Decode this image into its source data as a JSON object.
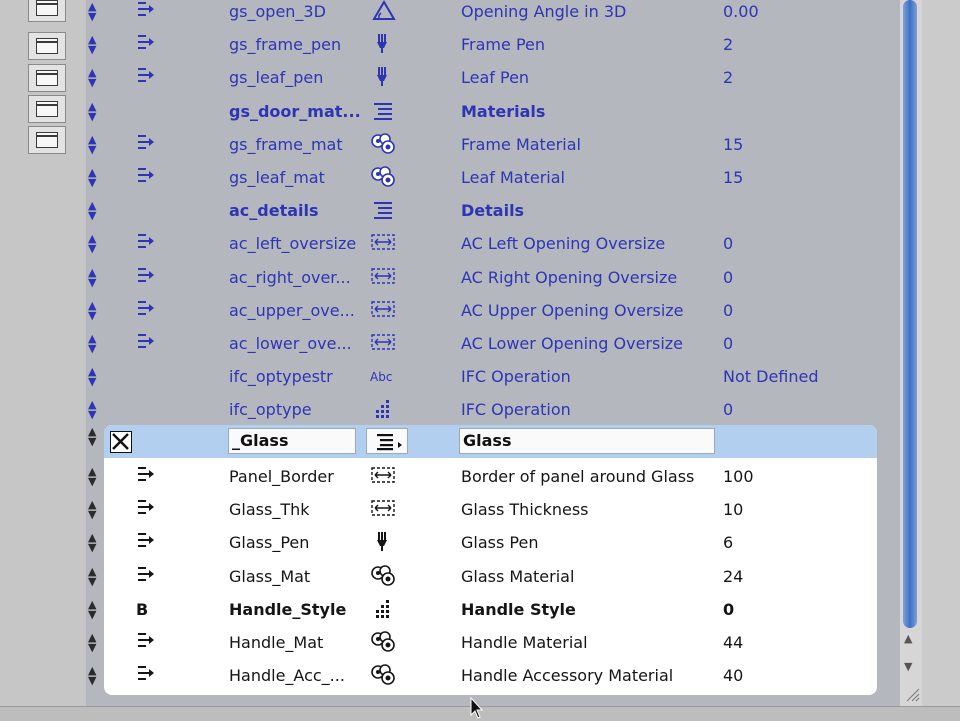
{
  "colors": {
    "list_bg": "#b5b7be",
    "dim_text": "#2d35b4",
    "selection": "#b3cff0",
    "scroll_thumb": "#3f6fc5"
  },
  "upper_rows": [
    {
      "flag": "set",
      "variable": "gs_open_3D",
      "type_icon": "angle-icon",
      "name": "Opening Angle in 3D",
      "value": "0.00",
      "bold": false
    },
    {
      "flag": "set",
      "variable": "gs_frame_pen",
      "type_icon": "pen-icon",
      "name": "Frame Pen",
      "value": "2",
      "bold": false
    },
    {
      "flag": "set",
      "variable": "gs_leaf_pen",
      "type_icon": "pen-icon",
      "name": "Leaf Pen",
      "value": "2",
      "bold": false
    },
    {
      "flag": "",
      "variable": "gs_door_mat...",
      "type_icon": "title-icon",
      "name": "Materials",
      "value": "",
      "bold": true
    },
    {
      "flag": "set",
      "variable": "gs_frame_mat",
      "type_icon": "material-icon",
      "name": "Frame Material",
      "value": "15",
      "bold": false
    },
    {
      "flag": "set",
      "variable": "gs_leaf_mat",
      "type_icon": "material-icon",
      "name": "Leaf Material",
      "value": "15",
      "bold": false
    },
    {
      "flag": "",
      "variable": "ac_details",
      "type_icon": "title-icon",
      "name": "Details",
      "value": "",
      "bold": true
    },
    {
      "flag": "set",
      "variable": "ac_left_oversize",
      "type_icon": "length-icon",
      "name": "AC Left Opening Oversize",
      "value": "0",
      "bold": false
    },
    {
      "flag": "set",
      "variable": "ac_right_over...",
      "type_icon": "length-icon",
      "name": "AC Right Opening Oversize",
      "value": "0",
      "bold": false
    },
    {
      "flag": "set",
      "variable": "ac_upper_ove...",
      "type_icon": "length-icon",
      "name": "AC Upper Opening Oversize",
      "value": "0",
      "bold": false
    },
    {
      "flag": "set",
      "variable": "ac_lower_ove...",
      "type_icon": "length-icon",
      "name": "AC Lower Opening Oversize",
      "value": "0",
      "bold": false
    },
    {
      "flag": "",
      "variable": "ifc_optypestr",
      "type_icon": "string-icon",
      "name": "IFC Operation",
      "value": "Not Defined",
      "bold": false
    },
    {
      "flag": "",
      "variable": "ifc_optype",
      "type_icon": "integer-icon",
      "name": "IFC Operation",
      "value": "0",
      "bold": false
    }
  ],
  "selected_row": {
    "variable": "_Glass",
    "type_icon": "title-dropdown-icon",
    "name": "Glass"
  },
  "lower_rows": [
    {
      "flag": "set",
      "variable": "Panel_Border",
      "type_icon": "length-icon",
      "name": "Border of panel around Glass",
      "value": "100",
      "bold": false
    },
    {
      "flag": "set",
      "variable": "Glass_Thk",
      "type_icon": "length-icon",
      "name": "Glass Thickness",
      "value": "10",
      "bold": false
    },
    {
      "flag": "set",
      "variable": "Glass_Pen",
      "type_icon": "pen-icon",
      "name": "Glass Pen",
      "value": "6",
      "bold": false
    },
    {
      "flag": "set",
      "variable": "Glass_Mat",
      "type_icon": "material-icon",
      "name": "Glass Material",
      "value": "24",
      "bold": false
    },
    {
      "flag": "B",
      "variable": "Handle_Style",
      "type_icon": "integer-icon",
      "name": "Handle Style",
      "value": "0",
      "bold": true
    },
    {
      "flag": "set",
      "variable": "Handle_Mat",
      "type_icon": "material-icon",
      "name": "Handle Material",
      "value": "44",
      "bold": false
    },
    {
      "flag": "set",
      "variable": "Handle_Acc_...",
      "type_icon": "material-icon",
      "name": "Handle Accessory Material",
      "value": "40",
      "bold": false
    }
  ]
}
